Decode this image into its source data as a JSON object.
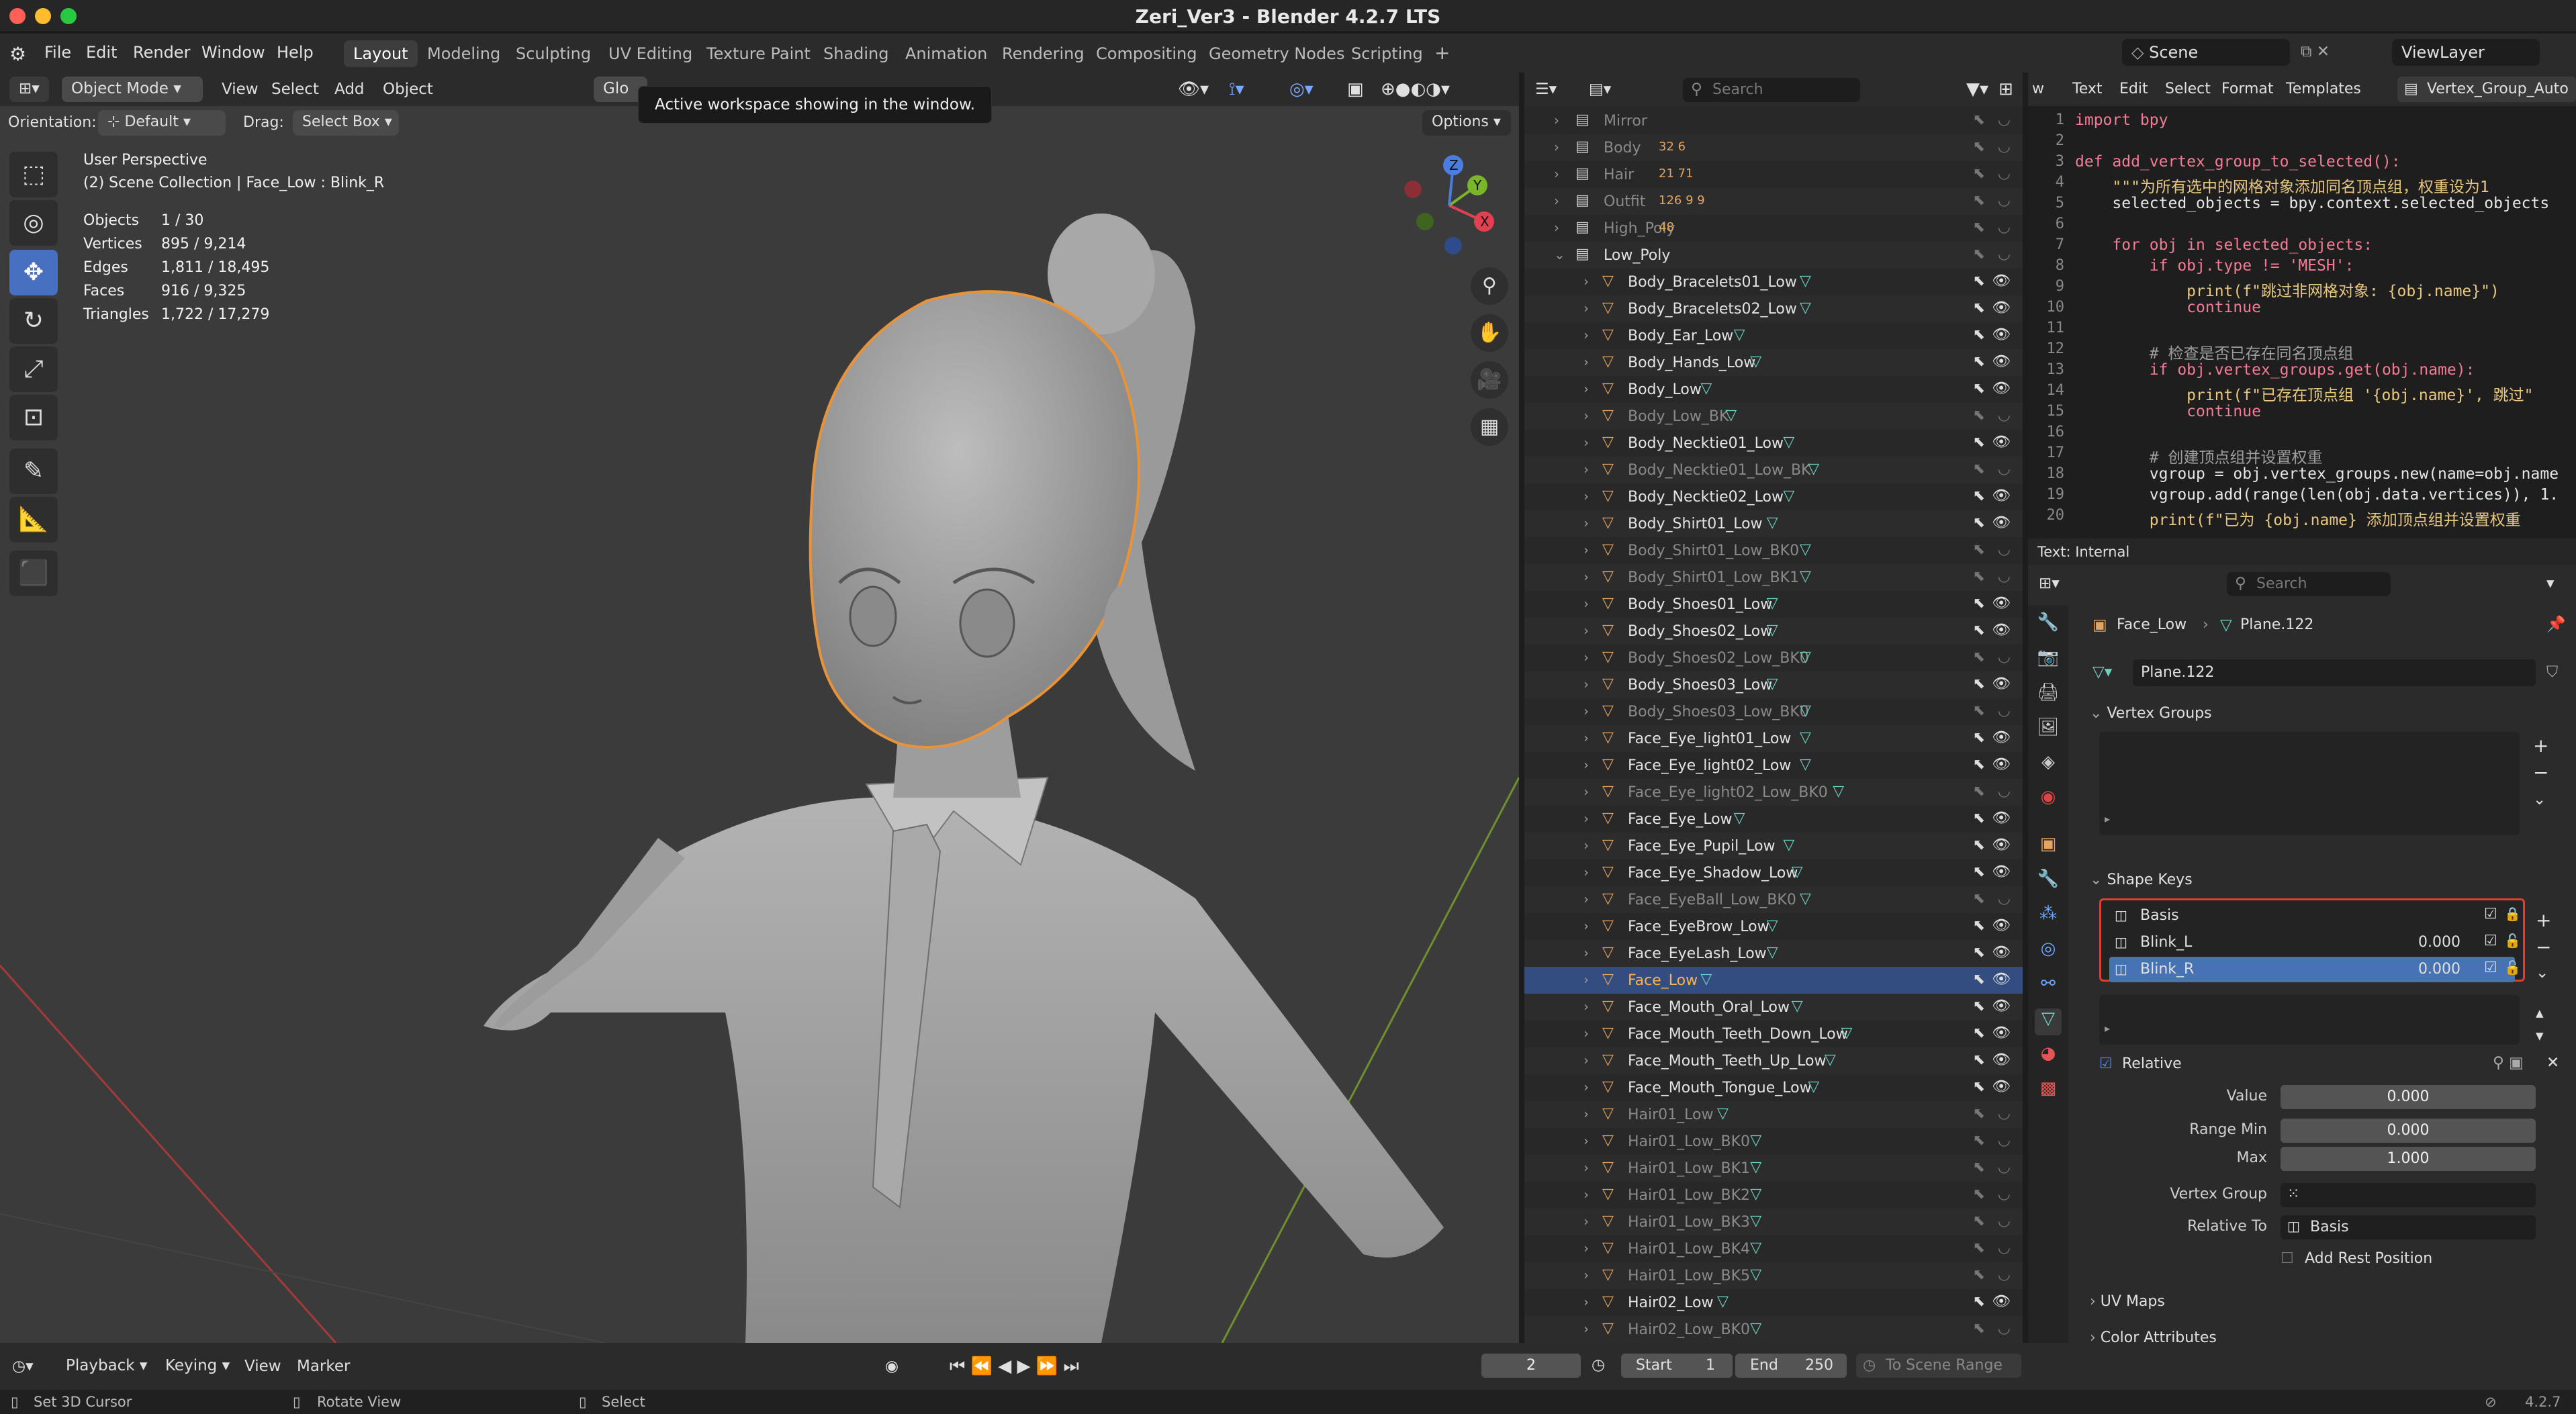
{
  "window": {
    "title": "Zeri_Ver3 - Blender 4.2.7 LTS"
  },
  "menus": [
    "File",
    "Edit",
    "Render",
    "Window",
    "Help"
  ],
  "workspaces": [
    "Layout",
    "Modeling",
    "Sculpting",
    "UV Editing",
    "Texture Paint",
    "Shading",
    "Animation",
    "Rendering",
    "Compositing",
    "Geometry Nodes",
    "Scripting"
  ],
  "scene": {
    "name": "Scene",
    "view_layer": "ViewLayer"
  },
  "viewport": {
    "mode": "Object Mode",
    "menu": [
      "View",
      "Select",
      "Add",
      "Object"
    ],
    "transform_short": "Glo",
    "orientation_label": "Orientation:",
    "orientation_value": "Default",
    "drag_label": "Drag:",
    "drag_value": "Select Box",
    "options": "Options",
    "tooltip": "Active workspace showing in the window.",
    "view_name": "User Perspective",
    "collection_info": "(2) Scene Collection | Face_Low : Blink_R",
    "stats": [
      {
        "label": "Objects",
        "value": "1 / 30"
      },
      {
        "label": "Vertices",
        "value": "895 / 9,214"
      },
      {
        "label": "Edges",
        "value": "1,811 / 18,495"
      },
      {
        "label": "Faces",
        "value": "916 / 9,325"
      },
      {
        "label": "Triangles",
        "value": "1,722 / 17,279"
      }
    ],
    "gizmo": {
      "x": "X",
      "y": "Y",
      "z": "Z"
    }
  },
  "outliner": {
    "search_placeholder": "Search",
    "collections": [
      {
        "name": "Mirror",
        "counts": ""
      },
      {
        "name": "Body",
        "counts": "32 6"
      },
      {
        "name": "Hair",
        "counts": "21 71"
      },
      {
        "name": "Outfit",
        "counts": "126 9 9"
      },
      {
        "name": "High_Poly",
        "counts": "48"
      },
      {
        "name": "Low_Poly",
        "counts": ""
      }
    ],
    "objects": [
      {
        "name": "Body_Bracelets01_Low",
        "dim": false
      },
      {
        "name": "Body_Bracelets02_Low",
        "dim": false
      },
      {
        "name": "Body_Ear_Low",
        "dim": false
      },
      {
        "name": "Body_Hands_Low",
        "dim": false
      },
      {
        "name": "Body_Low",
        "dim": false
      },
      {
        "name": "Body_Low_BK",
        "dim": true
      },
      {
        "name": "Body_Necktie01_Low",
        "dim": false
      },
      {
        "name": "Body_Necktie01_Low_BK",
        "dim": true
      },
      {
        "name": "Body_Necktie02_Low",
        "dim": false
      },
      {
        "name": "Body_Shirt01_Low",
        "dim": false
      },
      {
        "name": "Body_Shirt01_Low_BK0",
        "dim": true
      },
      {
        "name": "Body_Shirt01_Low_BK1",
        "dim": true
      },
      {
        "name": "Body_Shoes01_Low",
        "dim": false
      },
      {
        "name": "Body_Shoes02_Low",
        "dim": false
      },
      {
        "name": "Body_Shoes02_Low_BK0",
        "dim": true
      },
      {
        "name": "Body_Shoes03_Low",
        "dim": false
      },
      {
        "name": "Body_Shoes03_Low_BK0",
        "dim": true
      },
      {
        "name": "Face_Eye_light01_Low",
        "dim": false
      },
      {
        "name": "Face_Eye_light02_Low",
        "dim": false
      },
      {
        "name": "Face_Eye_light02_Low_BK0",
        "dim": true
      },
      {
        "name": "Face_Eye_Low",
        "dim": false
      },
      {
        "name": "Face_Eye_Pupil_Low",
        "dim": false
      },
      {
        "name": "Face_Eye_Shadow_Low",
        "dim": false
      },
      {
        "name": "Face_EyeBall_Low_BK0",
        "dim": true
      },
      {
        "name": "Face_EyeBrow_Low",
        "dim": false
      },
      {
        "name": "Face_EyeLash_Low",
        "dim": false
      },
      {
        "name": "Face_Low",
        "dim": false,
        "selected": true
      },
      {
        "name": "Face_Mouth_Oral_Low",
        "dim": false
      },
      {
        "name": "Face_Mouth_Teeth_Down_Low",
        "dim": false
      },
      {
        "name": "Face_Mouth_Teeth_Up_Low",
        "dim": false
      },
      {
        "name": "Face_Mouth_Tongue_Low",
        "dim": false
      },
      {
        "name": "Hair01_Low",
        "dim": true
      },
      {
        "name": "Hair01_Low_BK0",
        "dim": true
      },
      {
        "name": "Hair01_Low_BK1",
        "dim": true
      },
      {
        "name": "Hair01_Low_BK2",
        "dim": true
      },
      {
        "name": "Hair01_Low_BK3",
        "dim": true
      },
      {
        "name": "Hair01_Low_BK4",
        "dim": true
      },
      {
        "name": "Hair01_Low_BK5",
        "dim": true
      },
      {
        "name": "Hair02_Low",
        "dim": false
      },
      {
        "name": "Hair02_Low_BK0",
        "dim": true
      }
    ]
  },
  "text_editor": {
    "menu": [
      "w",
      "Text",
      "Edit",
      "Select",
      "Format",
      "Templates"
    ],
    "file": "Vertex_Group_Auto",
    "footer": "Text: Internal",
    "lines": [
      "import bpy",
      "",
      "def add_vertex_group_to_selected():",
      "    \"\"\"为所有选中的网格对象添加同名顶点组，权重设为1",
      "    selected_objects = bpy.context.selected_objects",
      "",
      "    for obj in selected_objects:",
      "        if obj.type != 'MESH':",
      "            print(f\"跳过非网格对象: {obj.name}\")",
      "            continue",
      "",
      "        # 检查是否已存在同名顶点组",
      "        if obj.vertex_groups.get(obj.name):",
      "            print(f\"已存在顶点组 '{obj.name}', 跳过\"",
      "            continue",
      "",
      "        # 创建顶点组并设置权重",
      "        vgroup = obj.vertex_groups.new(name=obj.name",
      "        vgroup.add(range(len(obj.data.vertices)), 1.",
      "        print(f\"已为 {obj.name} 添加顶点组并设置权重"
    ]
  },
  "properties": {
    "search_placeholder": "Search",
    "breadcrumb_object": "Face_Low",
    "breadcrumb_mesh": "Plane.122",
    "mesh_name": "Plane.122",
    "vertex_groups_title": "Vertex Groups",
    "shape_keys_title": "Shape Keys",
    "shape_keys": [
      {
        "name": "Basis",
        "value": ""
      },
      {
        "name": "Blink_L",
        "value": "0.000"
      },
      {
        "name": "Blink_R",
        "value": "0.000"
      }
    ],
    "relative_label": "Relative",
    "value_label": "Value",
    "value": "0.000",
    "range_min_label": "Range Min",
    "range_min": "0.000",
    "max_label": "Max",
    "max": "1.000",
    "vertex_group_label": "Vertex Group",
    "relative_to_label": "Relative To",
    "relative_to": "Basis",
    "add_rest_position": "Add Rest Position",
    "uv_maps": "UV Maps",
    "color_attributes": "Color Attributes"
  },
  "timeline": {
    "menu": [
      "Playback",
      "Keying",
      "View",
      "Marker"
    ],
    "current_frame": "2",
    "start_label": "Start",
    "start": "1",
    "end_label": "End",
    "end": "250",
    "to_scene_range": "To Scene Range"
  },
  "status": {
    "left": "Set 3D Cursor",
    "middle": "Rotate View",
    "right": "Select",
    "version": "4.2.7"
  },
  "colors": {
    "accent": "#4772b3",
    "selection_outline": "#e8933a",
    "highlight_box": "#e0402a"
  }
}
